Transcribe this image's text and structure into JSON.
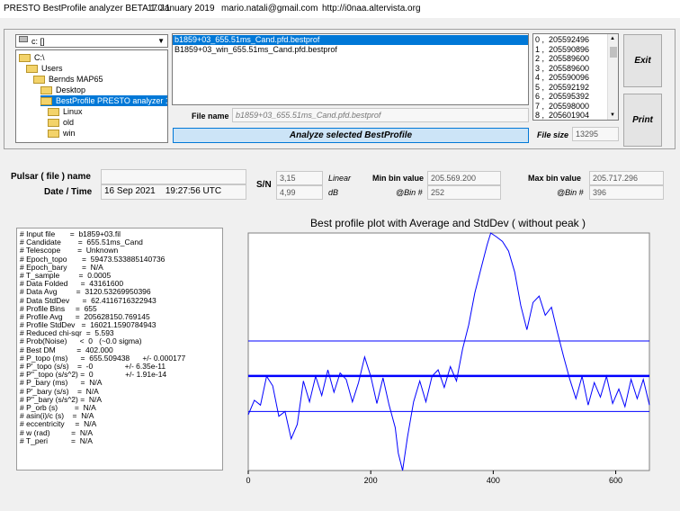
{
  "window": {
    "title": "PRESTO BestProfile analyzer BETA 1.0.1",
    "date": "17 January 2019",
    "email": "mario.natali@gmail.com",
    "url": "http://i0naa.altervista.org"
  },
  "drive": {
    "selected": "c: []"
  },
  "folders": [
    {
      "label": "C:\\",
      "level": 0,
      "selected": false
    },
    {
      "label": "Users",
      "level": 1,
      "selected": false
    },
    {
      "label": "Bernds MAP65",
      "level": 2,
      "selected": false
    },
    {
      "label": "Desktop",
      "level": 3,
      "selected": false
    },
    {
      "label": "BestProfile PRESTO analyzer 1.0.1.e",
      "level": 3,
      "selected": true
    },
    {
      "label": "Linux",
      "level": 4,
      "selected": false
    },
    {
      "label": "old",
      "level": 4,
      "selected": false
    },
    {
      "label": "win",
      "level": 4,
      "selected": false
    }
  ],
  "files": [
    {
      "label": "b1859+03_655.51ms_Cand.pfd.bestprof",
      "selected": true
    },
    {
      "label": "B1859+03_win_655.51ms_Cand.pfd.bestprof",
      "selected": false
    }
  ],
  "file_name": {
    "label": "File name",
    "value": "b1859+03_655.51ms_Cand.pfd.bestprof"
  },
  "analyze_button": "Analyze selected BestProfile",
  "bins": [
    "0 ,  205592496",
    "1 ,  205590896",
    "2 ,  205589600",
    "3 ,  205589600",
    "4 ,  205590096",
    "5 ,  205592192",
    "6 ,  205595392",
    "7 ,  205598000",
    "8 ,  205601904"
  ],
  "file_size": {
    "label": "File size",
    "value": "13295"
  },
  "buttons": {
    "exit": "Exit",
    "print": "Print"
  },
  "pulsar": {
    "name_label": "Pulsar ( file ) name",
    "name_value": "",
    "datetime_label": "Date / Time",
    "date_value": "16 Sep 2021",
    "time_value": "19:27:56  UTC",
    "sn_label": "S/N",
    "sn_linear": "3,15",
    "sn_linear_unit": "Linear",
    "sn_db": "4,99",
    "sn_db_unit": "dB",
    "min_label": "Min bin value",
    "min_value": "205.569.200",
    "min_bin_label": "@Bin #",
    "min_bin": "252",
    "max_label": "Max bin value",
    "max_value": "205.717.296",
    "max_bin_label": "@Bin #",
    "max_bin": "396"
  },
  "info_lines": [
    "# Input file       =  b1859+03.fil",
    "# Candidate        =  655.51ms_Cand",
    "# Telescope        =  Unknown",
    "# Epoch_topo       =  59473.533885140736",
    "# Epoch_bary       =  N/A",
    "# T_sample         =  0.0005",
    "# Data Folded      =  43161600",
    "# Data Avg         =  3120.53269950396",
    "# Data StdDev      =  62.4116716322943",
    "# Profile Bins     =  655",
    "# Profile Avg      =  205628150.769145",
    "# Profile StdDev   =  16021.1590784943",
    "# Reduced chi-sqr  =  5.593",
    "# Prob(Noise)      <  0   (~0.0 sigma)",
    "# Best DM          =  402.000",
    "# P_topo (ms)      =  655.509438      +/- 0.000177",
    "# P'_topo (s/s)    =  -0               +/- 6.35e-11",
    "# P''_topo (s/s^2) =  0               +/- 1.91e-14",
    "# P_bary (ms)      =  N/A",
    "# P'_bary (s/s)    =  N/A",
    "# P''_bary (s/s^2) =  N/A",
    "# P_orb (s)        =  N/A",
    "# asin(i)/c (s)    =  N/A",
    "# eccentricity     =  N/A",
    "# w (rad)          =  N/A",
    "# T_peri           =  N/A"
  ],
  "chart_data": {
    "type": "line",
    "title": "Best profile plot with  Average and StdDev ( without peak )",
    "xlabel": "",
    "ylabel": "",
    "xlim": [
      0,
      655
    ],
    "ylim": [
      205569200,
      205717296
    ],
    "x_ticks": [
      0,
      200,
      400,
      600
    ],
    "average": 205628150.77,
    "stddev_upper": 205650000,
    "stddev_lower": 205606000,
    "line_color": "#0000ff",
    "profile": [
      [
        0,
        205604000
      ],
      [
        10,
        205613000
      ],
      [
        20,
        205610000
      ],
      [
        30,
        205628000
      ],
      [
        40,
        205622000
      ],
      [
        50,
        205603000
      ],
      [
        60,
        205606000
      ],
      [
        70,
        205589000
      ],
      [
        80,
        205598000
      ],
      [
        90,
        205625000
      ],
      [
        100,
        205612000
      ],
      [
        110,
        205628000
      ],
      [
        120,
        205616000
      ],
      [
        130,
        205632000
      ],
      [
        140,
        205618000
      ],
      [
        150,
        205630000
      ],
      [
        160,
        205626000
      ],
      [
        170,
        205612000
      ],
      [
        180,
        205624000
      ],
      [
        190,
        205640000
      ],
      [
        200,
        205628000
      ],
      [
        210,
        205611000
      ],
      [
        220,
        205627000
      ],
      [
        230,
        205610000
      ],
      [
        240,
        205596000
      ],
      [
        245,
        205580000
      ],
      [
        252,
        205569200
      ],
      [
        260,
        205590000
      ],
      [
        270,
        205612000
      ],
      [
        280,
        205625000
      ],
      [
        290,
        205612000
      ],
      [
        300,
        205628000
      ],
      [
        310,
        205632000
      ],
      [
        320,
        205621000
      ],
      [
        330,
        205634000
      ],
      [
        340,
        205625000
      ],
      [
        350,
        205645000
      ],
      [
        360,
        205660000
      ],
      [
        370,
        205680000
      ],
      [
        380,
        205695000
      ],
      [
        390,
        205710000
      ],
      [
        396,
        205717296
      ],
      [
        405,
        205715000
      ],
      [
        415,
        205712000
      ],
      [
        425,
        205706000
      ],
      [
        435,
        205693000
      ],
      [
        445,
        205672000
      ],
      [
        455,
        205657000
      ],
      [
        465,
        205674000
      ],
      [
        475,
        205678000
      ],
      [
        485,
        205666000
      ],
      [
        495,
        205671000
      ],
      [
        505,
        205655000
      ],
      [
        515,
        205640000
      ],
      [
        525,
        205626000
      ],
      [
        535,
        205614000
      ],
      [
        545,
        205628000
      ],
      [
        555,
        205610000
      ],
      [
        565,
        205624000
      ],
      [
        575,
        205615000
      ],
      [
        585,
        205628000
      ],
      [
        595,
        205611000
      ],
      [
        605,
        205620000
      ],
      [
        615,
        205609000
      ],
      [
        625,
        205626000
      ],
      [
        635,
        205614000
      ],
      [
        645,
        205626000
      ],
      [
        655,
        205610000
      ]
    ]
  }
}
